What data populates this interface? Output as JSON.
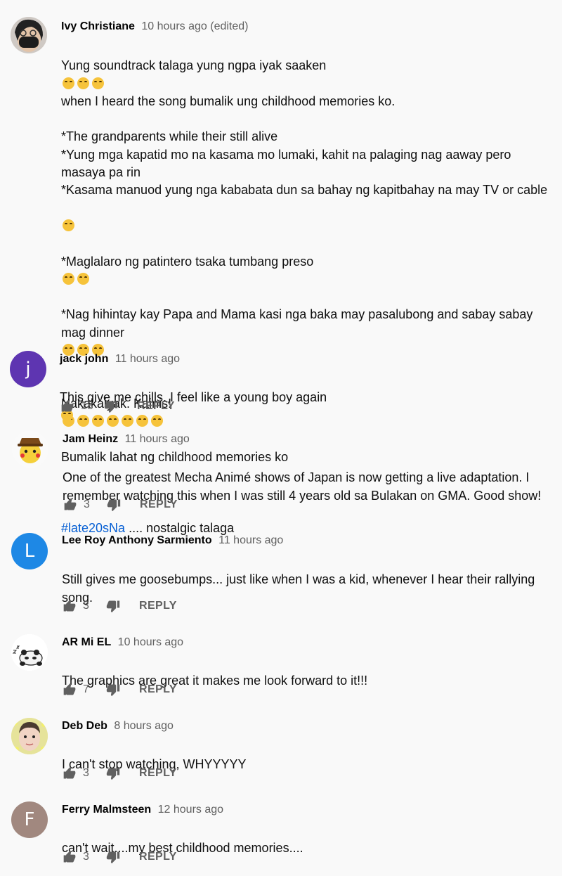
{
  "reply_label": "REPLY",
  "colors": {
    "author": "#030303",
    "timestamp": "#606060",
    "hashtag": "#065fd4",
    "background": "#f9f9f9",
    "avatar_jack_john": "#5e35b1",
    "avatar_lee_roy": "#1e88e5",
    "avatar_ferry": "#a1887f"
  },
  "icons": {
    "like": "thumb-up-icon",
    "dislike": "thumb-down-icon",
    "emoji": "loudly-crying-face-emoji"
  },
  "comments": [
    {
      "author": "Ivy Christiane",
      "time": "10 hours ago (edited)",
      "text": "Yung soundtrack talaga yung ngpa iyak saaken",
      "text_b": "when I heard the song bumalik ung childhood memories ko.\n\n*The grandparents while their still alive\n*Yung mga kapatid mo na kasama mo lumaki, kahit na palaging nag aaway pero masaya pa rin\n*Kasama manuod yung nga kababata dun sa bahay ng  kapitbahay na may TV or cable",
      "text_c": "*Maglalaro ng patintero tsaka tumbang preso",
      "text_d": "*Nag hihintay kay Papa and Mama kasi nga baka may pasalubong and sabay sabay mag dinner",
      "text_e": "Nakakaiyak. Kainis!",
      "text_f": "Bumalik lahat ng childhood memories ko",
      "hashtag": "#late20sNa",
      "text_g": " .... nostalgic talaga"
    },
    {
      "author": "jack john",
      "time": "11 hours ago",
      "avatar_letter": "j",
      "text": "This give me chills. I feel like a young boy again",
      "likes": "18"
    },
    {
      "author": "Jam Heinz",
      "time": "11 hours ago",
      "text": "One of the greatest Mecha Animé shows of Japan is now getting a live adaptation. I remember watching this when I was still 4 years old sa Bulakan on GMA. Good show!",
      "likes": "3"
    },
    {
      "author": "Lee Roy Anthony Sarmiento",
      "time": "11 hours ago",
      "avatar_letter": "L",
      "text": "Still gives me goosebumps... just like when I was a kid, whenever I hear their rallying song.",
      "likes": "3"
    },
    {
      "author": "AR Mi EL",
      "time": "10 hours ago",
      "text": "The graphics are great it makes me look forward to it!!!",
      "likes": "7"
    },
    {
      "author": "Deb Deb",
      "time": "8 hours ago",
      "text": "I can't stop watching, WHYYYYY",
      "likes": "3"
    },
    {
      "author": "Ferry Malmsteen",
      "time": "12 hours ago",
      "avatar_letter": "F",
      "text": "can't wait....my best childhood memories....",
      "likes": "3"
    }
  ]
}
